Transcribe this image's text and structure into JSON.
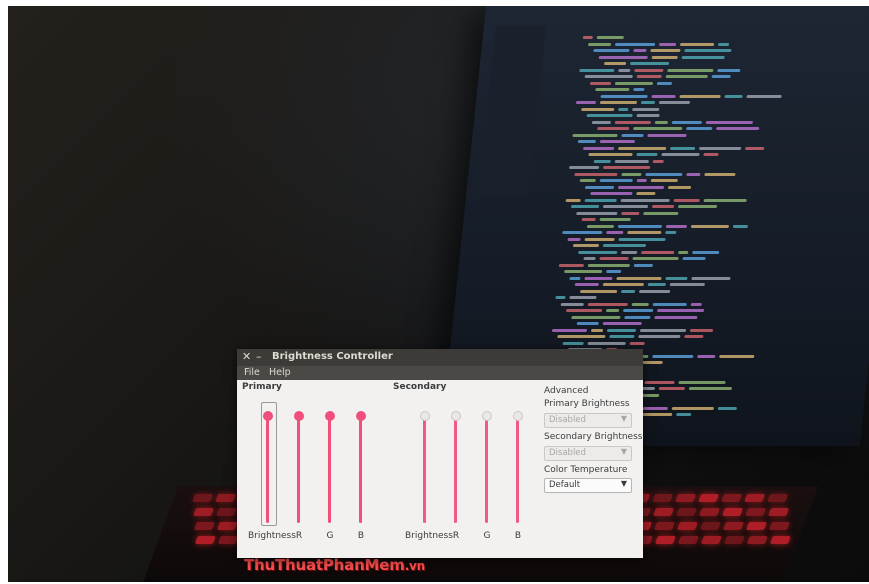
{
  "window": {
    "title": "Brightness Controller",
    "close_glyph": "✕",
    "minimize_glyph": "–",
    "menu": [
      "File",
      "Help"
    ]
  },
  "primary": {
    "heading": "Primary",
    "sliders": [
      {
        "label": "Brightness",
        "level": 1.0
      },
      {
        "label": "R",
        "level": 1.0
      },
      {
        "label": "G",
        "level": 1.0
      },
      {
        "label": "B",
        "level": 1.0
      }
    ]
  },
  "secondary": {
    "heading": "Secondary",
    "sliders": [
      {
        "label": "Brightness",
        "level": 1.0,
        "enabled": false
      },
      {
        "label": "R",
        "level": 1.0,
        "enabled": false
      },
      {
        "label": "G",
        "level": 1.0,
        "enabled": false
      },
      {
        "label": "B",
        "level": 1.0,
        "enabled": false
      }
    ]
  },
  "advanced": {
    "heading": "Advanced",
    "primary_label": "Primary Brightness",
    "primary_value": "Disabled",
    "secondary_label": "Secondary Brightness",
    "secondary_value": "Disabled",
    "temp_label": "Color Temperature",
    "temp_value": "Default",
    "arrow_glyph": "▼"
  },
  "watermark": {
    "text": "ThuThuatPhanMem",
    "suffix": ".vn"
  },
  "colors": {
    "accent": "#ee4f7c",
    "titlebar": "#3c3b37",
    "window_bg": "#f2f1f0"
  }
}
